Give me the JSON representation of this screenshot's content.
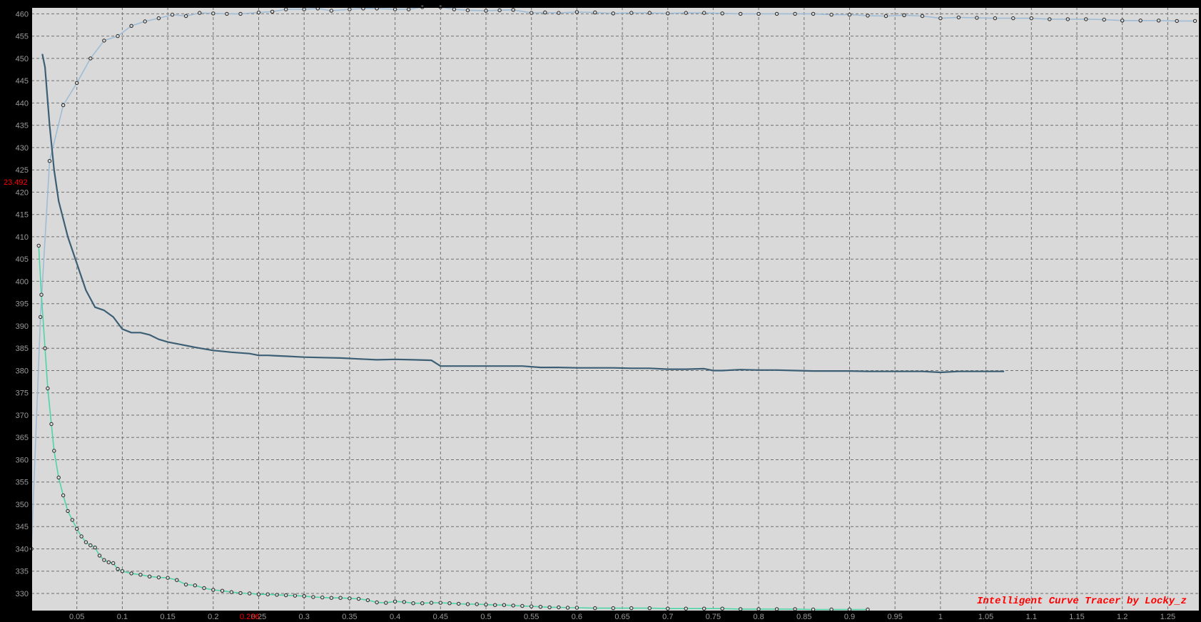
{
  "colors": {
    "background": "#d9d9d9",
    "frame": "#000000",
    "grid": "#707070",
    "tick_text": "#9a9a9a",
    "cursor_text": "#ff0000",
    "watermark": "#ff0000"
  },
  "watermark": "Intelligent Curve Tracer by Locky_z",
  "cursor": {
    "y_readout": "23.492",
    "x_readout": "0.236"
  },
  "chart_data": {
    "type": "line",
    "title": "",
    "xlabel": "",
    "ylabel": "",
    "grid": true,
    "legend": "none",
    "xlim": [
      0.0,
      1.285
    ],
    "ylim": [
      326,
      461.5
    ],
    "x_ticks": [
      0.05,
      0.1,
      0.15,
      0.2,
      0.25,
      0.3,
      0.35,
      0.4,
      0.45,
      0.5,
      0.55,
      0.6,
      0.65,
      0.7,
      0.75,
      0.8,
      0.85,
      0.9,
      0.95,
      1,
      1.05,
      1.1,
      1.15,
      1.2,
      1.25
    ],
    "x_tick_labels": [
      "0.05",
      "0.1",
      "0.15",
      "0.2",
      "0.25",
      "0.3",
      "0.35",
      "0.4",
      "0.45",
      "0.5",
      "0.55",
      "0.6",
      "0.65",
      "0.7",
      "0.75",
      "0.8",
      "0.85",
      "0.9",
      "0.95",
      "1",
      "1.05",
      "1.1",
      "1.15",
      "1.2",
      "1.25"
    ],
    "y_ticks": [
      330,
      335,
      340,
      345,
      350,
      355,
      360,
      365,
      370,
      375,
      380,
      385,
      390,
      395,
      400,
      405,
      410,
      415,
      420,
      425,
      430,
      435,
      440,
      445,
      450,
      455,
      460
    ],
    "y_tick_labels": [
      "330",
      "335",
      "340",
      "345",
      "350",
      "355",
      "360",
      "365",
      "370",
      "375",
      "380",
      "385",
      "390",
      "395",
      "400",
      "405",
      "410",
      "415",
      "420",
      "425",
      "430",
      "435",
      "440",
      "445",
      "450",
      "455",
      "460"
    ],
    "series": [
      {
        "color": "#9fbcd6",
        "markers": true,
        "x": [
          0.0,
          0.01,
          0.02,
          0.035,
          0.05,
          0.065,
          0.08,
          0.095,
          0.11,
          0.125,
          0.14,
          0.155,
          0.17,
          0.185,
          0.2,
          0.215,
          0.23,
          0.25,
          0.265,
          0.28,
          0.3,
          0.315,
          0.33,
          0.35,
          0.365,
          0.38,
          0.4,
          0.415,
          0.43,
          0.45,
          0.465,
          0.48,
          0.5,
          0.515,
          0.53,
          0.55,
          0.565,
          0.58,
          0.6,
          0.62,
          0.64,
          0.66,
          0.68,
          0.7,
          0.72,
          0.74,
          0.76,
          0.78,
          0.8,
          0.82,
          0.84,
          0.86,
          0.88,
          0.9,
          0.92,
          0.94,
          0.96,
          0.98,
          1.0,
          1.02,
          1.04,
          1.06,
          1.08,
          1.1,
          1.12,
          1.14,
          1.16,
          1.18,
          1.2,
          1.22,
          1.24,
          1.26,
          1.28
        ],
        "y": [
          340,
          392,
          427,
          439.5,
          444.5,
          450,
          454,
          455,
          457.3,
          458.3,
          459,
          459.8,
          459.5,
          460.2,
          460.1,
          460,
          460,
          460.3,
          460.5,
          461,
          461,
          461.2,
          460.7,
          461,
          461.2,
          461.2,
          461,
          461,
          461.5,
          461.5,
          461,
          460.8,
          460.7,
          460.8,
          460.9,
          460.2,
          460.3,
          460.2,
          460.4,
          460.3,
          460.1,
          460.2,
          460.2,
          460.1,
          460.2,
          460.2,
          460.1,
          460,
          460,
          460,
          460,
          460,
          459.8,
          459.8,
          459.6,
          459.5,
          459.7,
          459.5,
          459,
          459.2,
          459.1,
          459,
          459,
          459,
          458.8,
          458.8,
          458.8,
          458.7,
          458.5,
          458.5,
          458.5,
          458.4,
          458.4
        ]
      },
      {
        "color": "#3c5f75",
        "markers": false,
        "x": [
          0.012,
          0.015,
          0.02,
          0.025,
          0.03,
          0.04,
          0.05,
          0.06,
          0.07,
          0.08,
          0.09,
          0.1,
          0.11,
          0.12,
          0.13,
          0.14,
          0.15,
          0.16,
          0.18,
          0.2,
          0.22,
          0.24,
          0.25,
          0.26,
          0.28,
          0.3,
          0.32,
          0.34,
          0.36,
          0.38,
          0.4,
          0.42,
          0.44,
          0.45,
          0.46,
          0.48,
          0.5,
          0.52,
          0.54,
          0.56,
          0.58,
          0.6,
          0.62,
          0.64,
          0.66,
          0.68,
          0.7,
          0.72,
          0.74,
          0.75,
          0.76,
          0.78,
          0.8,
          0.82,
          0.84,
          0.86,
          0.88,
          0.9,
          0.92,
          0.94,
          0.96,
          0.98,
          1.0,
          1.02,
          1.04,
          1.06,
          1.07
        ],
        "y": [
          451,
          448,
          435,
          425,
          418,
          410,
          404,
          398,
          394.2,
          393.5,
          392,
          389.3,
          388.5,
          388.5,
          388,
          387,
          386.4,
          386,
          385.2,
          384.5,
          384.1,
          383.8,
          383.4,
          383.4,
          383.2,
          383,
          382.9,
          382.8,
          382.6,
          382.4,
          382.5,
          382.4,
          382.3,
          381,
          381,
          381,
          381,
          381,
          381,
          380.7,
          380.7,
          380.6,
          380.6,
          380.6,
          380.5,
          380.5,
          380.3,
          380.3,
          380.4,
          380,
          380,
          380.2,
          380.1,
          380.1,
          380,
          379.9,
          379.9,
          379.9,
          379.8,
          379.8,
          379.8,
          379.8,
          379.6,
          379.8,
          379.8,
          379.8,
          379.8
        ]
      },
      {
        "color": "#4fd4a8",
        "markers": true,
        "x": [
          0.008,
          0.011,
          0.015,
          0.018,
          0.022,
          0.025,
          0.03,
          0.035,
          0.04,
          0.045,
          0.05,
          0.055,
          0.06,
          0.065,
          0.07,
          0.075,
          0.08,
          0.085,
          0.09,
          0.095,
          0.1,
          0.11,
          0.12,
          0.13,
          0.14,
          0.15,
          0.16,
          0.17,
          0.18,
          0.19,
          0.2,
          0.21,
          0.22,
          0.23,
          0.24,
          0.25,
          0.26,
          0.27,
          0.28,
          0.29,
          0.3,
          0.31,
          0.32,
          0.33,
          0.34,
          0.35,
          0.36,
          0.37,
          0.38,
          0.39,
          0.4,
          0.41,
          0.42,
          0.43,
          0.44,
          0.45,
          0.46,
          0.47,
          0.48,
          0.49,
          0.5,
          0.51,
          0.52,
          0.53,
          0.54,
          0.55,
          0.56,
          0.57,
          0.58,
          0.59,
          0.6,
          0.62,
          0.64,
          0.66,
          0.68,
          0.7,
          0.72,
          0.74,
          0.76,
          0.78,
          0.8,
          0.82,
          0.84,
          0.86,
          0.88,
          0.9,
          0.92
        ],
        "y": [
          408,
          397,
          385,
          376,
          368,
          362,
          356,
          352,
          348.5,
          346.5,
          344.5,
          342.8,
          341.5,
          340.8,
          340.3,
          338.5,
          337.5,
          337,
          336.8,
          335.5,
          335,
          334.5,
          334.2,
          333.8,
          333.6,
          333.5,
          333,
          332,
          331.8,
          331.2,
          330.8,
          330.6,
          330.3,
          330.1,
          330,
          329.8,
          329.8,
          329.7,
          329.6,
          329.5,
          329.4,
          329.2,
          329.1,
          329,
          329,
          328.9,
          328.8,
          328.5,
          328,
          327.9,
          328.2,
          328.1,
          327.8,
          327.8,
          327.9,
          327.9,
          327.8,
          327.7,
          327.6,
          327.6,
          327.5,
          327.4,
          327.4,
          327.3,
          327.2,
          327.1,
          327,
          326.9,
          326.9,
          326.8,
          326.8,
          326.7,
          326.7,
          326.7,
          326.7,
          326.6,
          326.6,
          326.6,
          326.6,
          326.5,
          326.5,
          326.5,
          326.5,
          326.4,
          326.4,
          326.4,
          326.4
        ]
      }
    ]
  }
}
